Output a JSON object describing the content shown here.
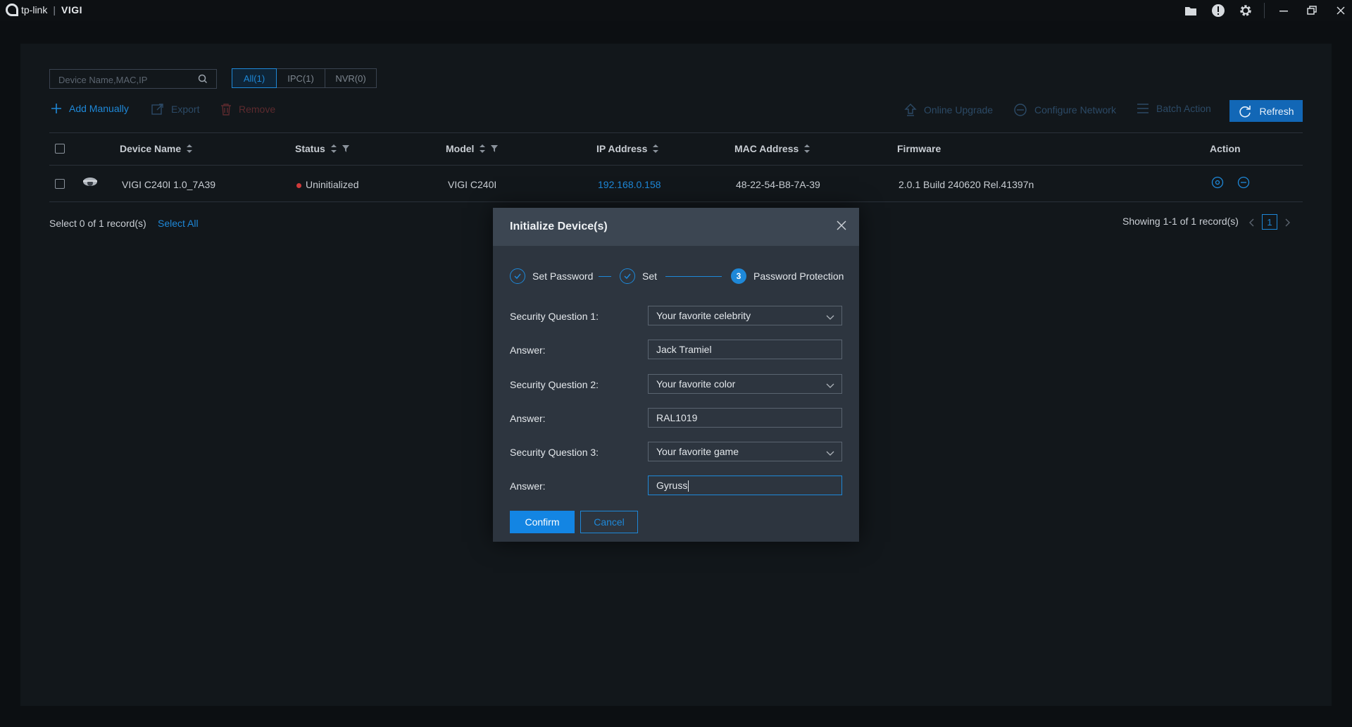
{
  "app": {
    "logo_brand": "tp-link",
    "logo_separator": "|",
    "logo_product": "VIGI"
  },
  "search": {
    "placeholder": "Device Name,MAC,IP"
  },
  "filter_tabs": [
    {
      "label": "All(1)",
      "active": true
    },
    {
      "label": "IPC(1)",
      "active": false
    },
    {
      "label": "NVR(0)",
      "active": false
    }
  ],
  "toolbar": {
    "add_manually": "Add Manually",
    "export": "Export",
    "remove": "Remove",
    "online_upgrade": "Online Upgrade",
    "configure_network": "Configure Network",
    "batch_action": "Batch Action",
    "refresh": "Refresh"
  },
  "table": {
    "columns": {
      "device_name": "Device Name",
      "status": "Status",
      "model": "Model",
      "ip": "IP Address",
      "mac": "MAC Address",
      "firmware": "Firmware",
      "action": "Action"
    },
    "rows": [
      {
        "device_name": "VIGI C240I 1.0_7A39",
        "status": "Uninitialized",
        "model": "VIGI C240I",
        "ip": "192.168.0.158",
        "mac": "48-22-54-B8-7A-39",
        "firmware": "2.0.1 Build 240620 Rel.41397n"
      }
    ]
  },
  "footer": {
    "selection": "Select 0 of 1 record(s)",
    "select_all": "Select All",
    "showing": "Showing 1-1 of 1 record(s)",
    "page": "1"
  },
  "modal": {
    "title": "Initialize Device(s)",
    "steps": [
      {
        "label": "Set Password",
        "state": "done"
      },
      {
        "label": "Set",
        "state": "done"
      },
      {
        "label": "Password Protection",
        "state": "current",
        "number": "3"
      }
    ],
    "fields": [
      {
        "label": "Security Question 1:",
        "value": "Your favorite celebrity",
        "type": "select"
      },
      {
        "label": "Answer:",
        "value": "Jack Tramiel",
        "type": "text"
      },
      {
        "label": "Security Question 2:",
        "value": "Your favorite color",
        "type": "select"
      },
      {
        "label": "Answer:",
        "value": "RAL1019",
        "type": "text"
      },
      {
        "label": "Security Question 3:",
        "value": "Your favorite game",
        "type": "select"
      },
      {
        "label": "Answer:",
        "value": "Gyruss",
        "type": "text"
      }
    ],
    "confirm": "Confirm",
    "cancel": "Cancel"
  },
  "colors": {
    "accent": "#1e88d8",
    "status_uninitialized": "#d03a3a"
  }
}
